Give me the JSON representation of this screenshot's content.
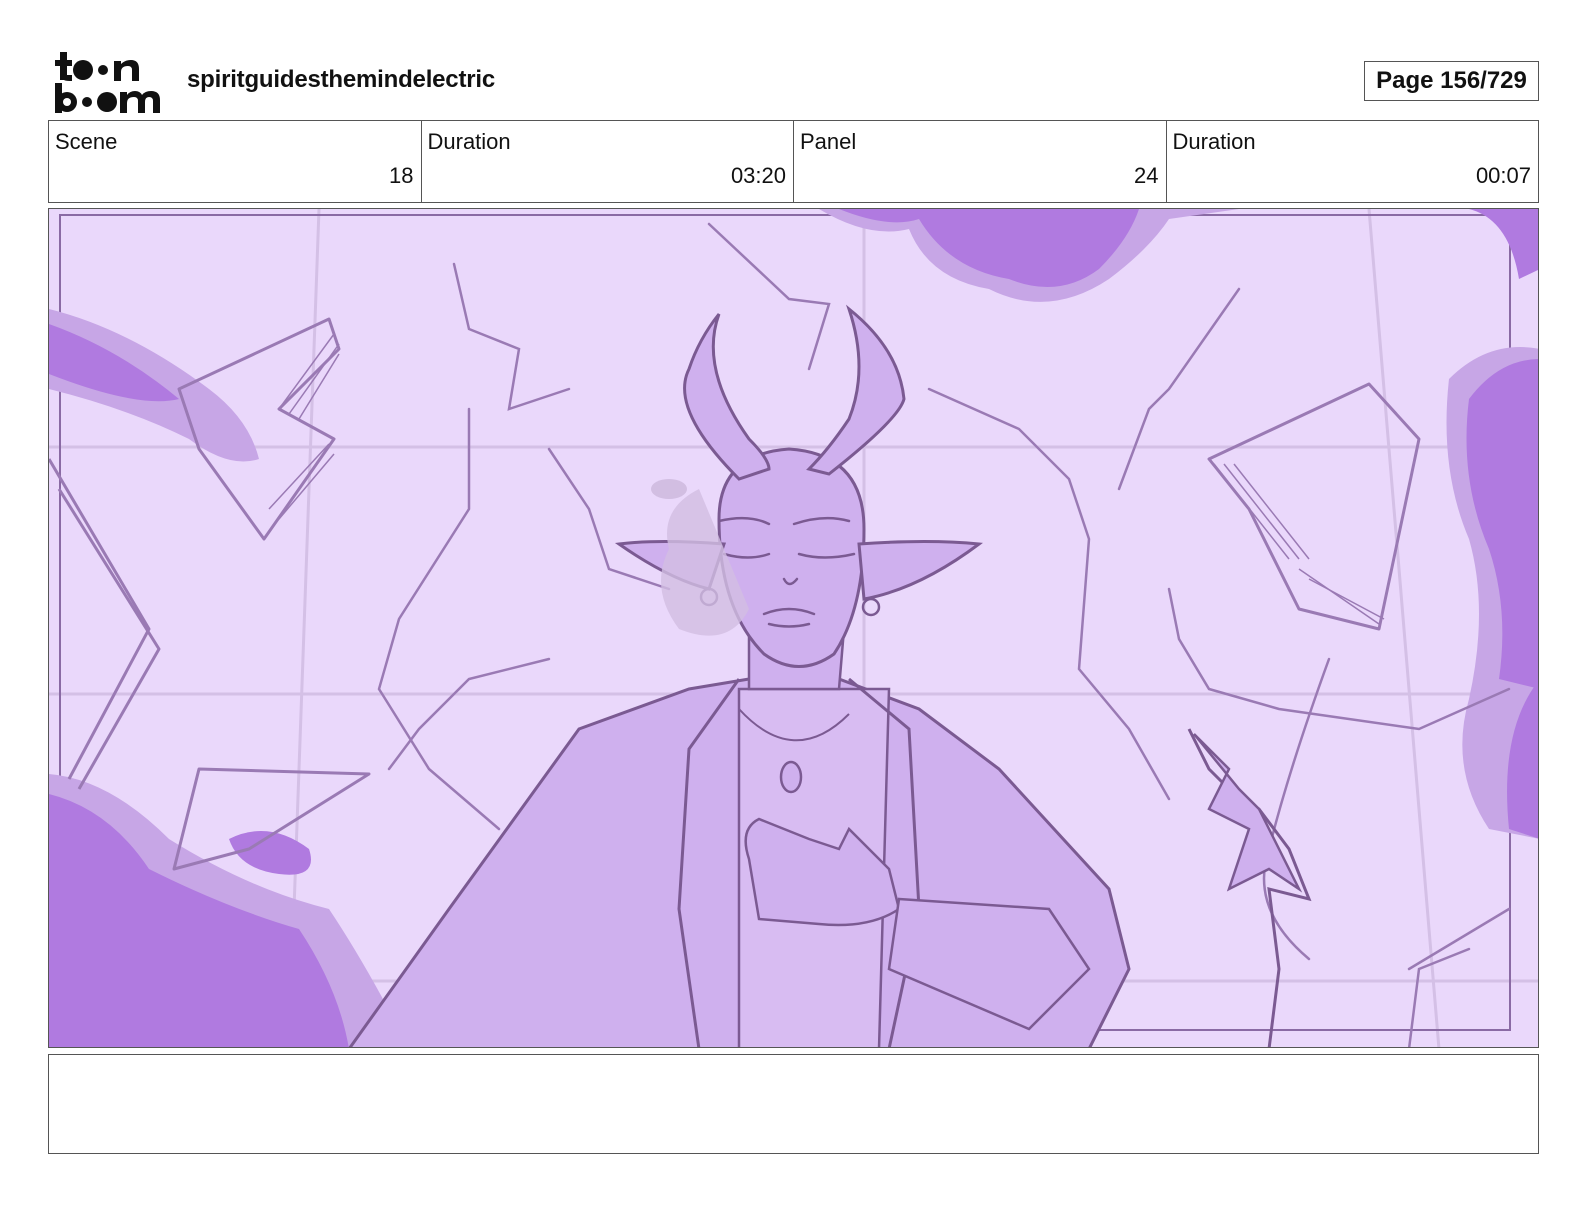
{
  "header": {
    "logo_text": "toon boom",
    "project_title": "spiritguidesthemindelectric",
    "page_indicator": "Page 156/729"
  },
  "info": [
    {
      "label": "Scene",
      "value": "18"
    },
    {
      "label": "Duration",
      "value": "03:20"
    },
    {
      "label": "Panel",
      "value": "24"
    },
    {
      "label": "Duration",
      "value": "00:07"
    }
  ],
  "panel": {
    "background_color": "#ead8fb",
    "accent_color": "#b07ae0",
    "line_color": "#7b5a92"
  },
  "notes": {
    "text": ""
  }
}
